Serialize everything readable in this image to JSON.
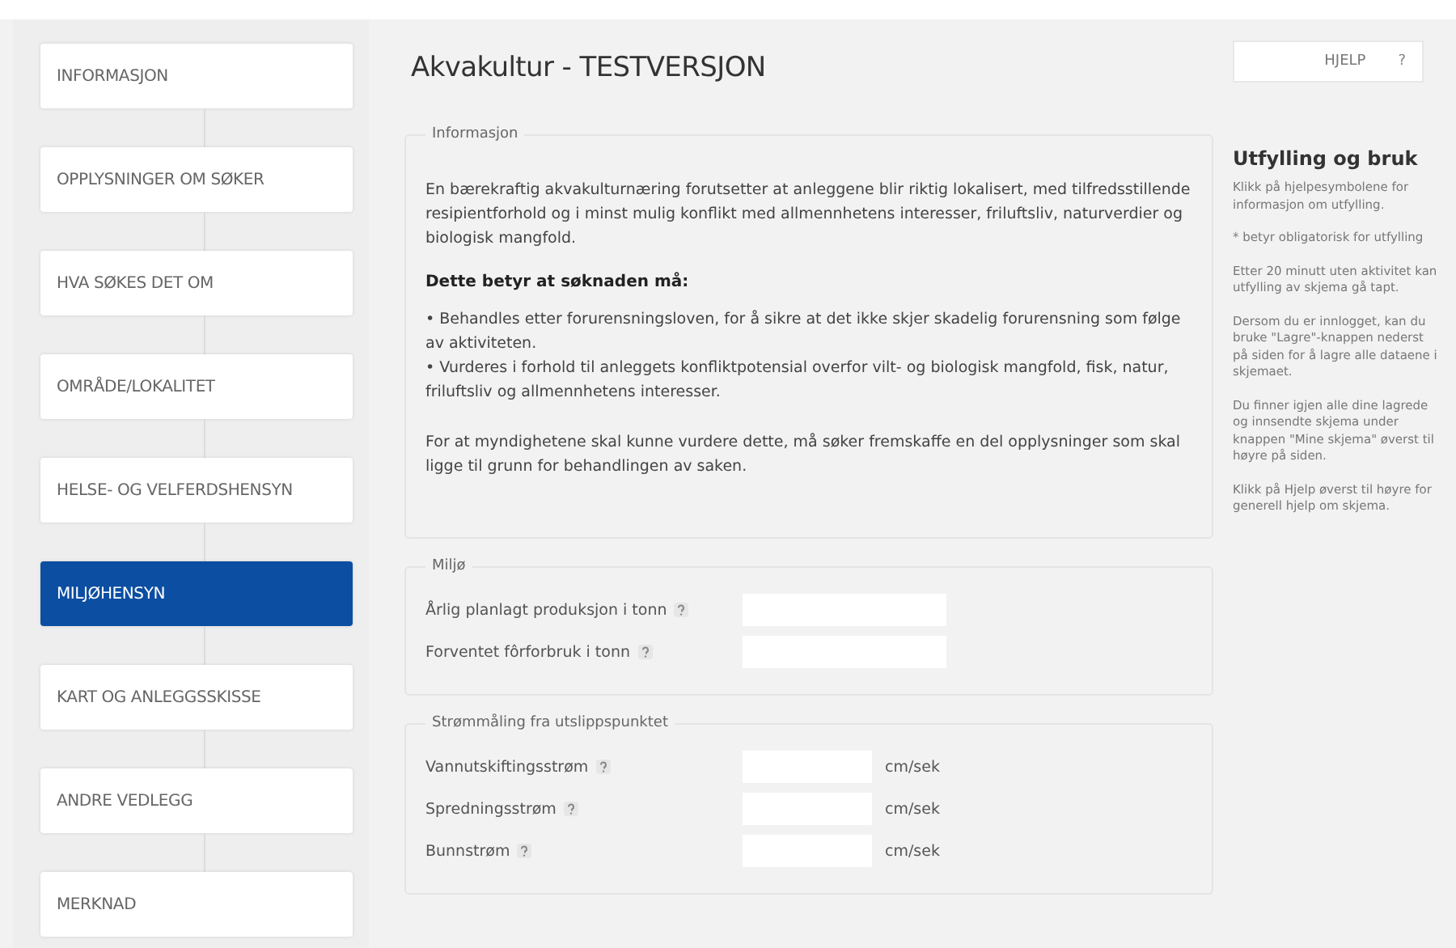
{
  "nav": {
    "items": [
      {
        "label": "INFORMASJON",
        "selected": false
      },
      {
        "label": "OPPLYSNINGER OM SØKER",
        "selected": false
      },
      {
        "label": "HVA SØKES DET OM",
        "selected": false
      },
      {
        "label": "OMRÅDE/LOKALITET",
        "selected": false
      },
      {
        "label": "HELSE- OG VELFERDSHENSYN",
        "selected": false
      },
      {
        "label": "MILJØHENSYN",
        "selected": true
      },
      {
        "label": "KART OG ANLEGGSSKISSE",
        "selected": false
      },
      {
        "label": "ANDRE VEDLEGG",
        "selected": false
      },
      {
        "label": "MERKNAD",
        "selected": false
      }
    ]
  },
  "title": "Akvakultur - TESTVERSJON",
  "help_button": {
    "label": "HJELP",
    "mark": "?"
  },
  "info": {
    "legend": "Informasjon",
    "paragraphs": [
      {
        "kind": "text",
        "text": "En bærekraftig akvakulturnæring forutsetter at anleggene blir riktig lokalisert, med tilfredsstillende resipientforhold og i minst mulig konflikt med allmennhetens interesser, friluftsliv, naturverdier og biologisk mangfold."
      },
      {
        "kind": "heading",
        "text": "Dette betyr at søknaden må:"
      },
      {
        "kind": "list",
        "lines": [
          "• Behandles etter forurensningsloven, for å sikre at det ikke skjer skadelig forurensning som følge av aktiviteten.",
          "• Vurderes i forhold til anleggets konfliktpotensial overfor vilt- og biologisk mangfold, fisk, natur, friluftsliv og allmennhetens interesser."
        ]
      },
      {
        "kind": "text",
        "text": "For at myndighetene skal kunne vurdere dette, må søker fremskaffe en del opplysninger som skal ligge til grunn for behandlingen av saken."
      }
    ]
  },
  "fieldsets": [
    {
      "legend": "Miljø",
      "fields": [
        {
          "label": "Årlig planlagt produksjon i tonn",
          "help": true
        },
        {
          "label": "Forventet fôrforbruk i tonn",
          "help": true
        }
      ]
    },
    {
      "legend": "Strømmåling fra utslippspunktet",
      "fields": [
        {
          "label": "Vannutskiftingsstrøm",
          "help": true,
          "unit": "cm/sek"
        },
        {
          "label": "Spredningsstrøm",
          "help": true,
          "unit": "cm/sek"
        },
        {
          "label": "Bunnstrøm",
          "help": true,
          "unit": "cm/sek"
        }
      ]
    }
  ],
  "guide": {
    "title": "Utfylling og bruk",
    "paragraphs": [
      "Klikk på hjelpesymbolene for informasjon om utfylling.",
      "* betyr obligatorisk for utfylling",
      "Etter 20 minutt uten aktivitet kan utfylling av skjema gå tapt.",
      "Dersom du er innlogget, kan du bruke \"Lagre\"-knappen nederst på siden for å lagre alle dataene i skjemaet.",
      "Du finner igjen alle dine lagrede og innsendte skjema under knappen \"Mine skjema\" øverst til høyre på siden.",
      "Klikk på Hjelp øverst til høyre for generell hjelp om skjema."
    ]
  }
}
